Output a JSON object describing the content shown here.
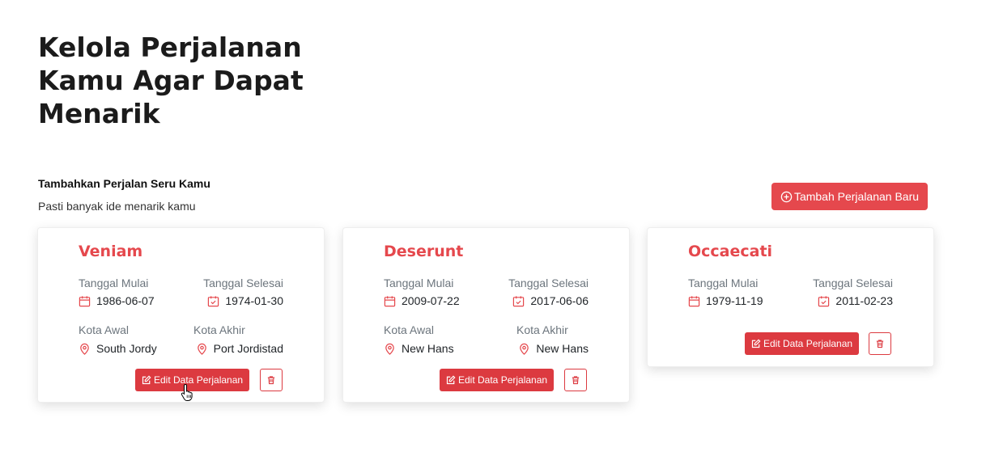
{
  "hero": {
    "title_line1": "Kelola Perjalanan",
    "title_line2": "Kamu Agar Dapat",
    "title_line3": "Menarik"
  },
  "section": {
    "title": "Tambahkan Perjalan Seru Kamu",
    "subtitle": "Pasti banyak ide menarik kamu"
  },
  "actions": {
    "add_label": "Tambah Perjalanan Baru"
  },
  "labels": {
    "start_date": "Tanggal Mulai",
    "end_date": "Tanggal Selesai",
    "start_city": "Kota Awal",
    "end_city": "Kota Akhir",
    "edit": "Edit Data Perjalanan"
  },
  "colors": {
    "accent": "#e5484d",
    "button": "#dc3a40"
  },
  "icons": {
    "add": "plus-circle-icon",
    "start_date": "calendar-icon",
    "end_date": "calendar-check-icon",
    "city": "map-pin-icon",
    "edit": "edit-icon",
    "delete": "trash-icon"
  },
  "trips": [
    {
      "title": "Veniam",
      "start_date": "1986-06-07",
      "end_date": "1974-01-30",
      "start_city": "South Jordy",
      "end_city": "Port Jordistad"
    },
    {
      "title": "Deserunt",
      "start_date": "2009-07-22",
      "end_date": "2017-06-06",
      "start_city": "New Hans",
      "end_city": "New Hans"
    },
    {
      "title": "Occaecati",
      "start_date": "1979-11-19",
      "end_date": "2011-02-23"
    }
  ]
}
